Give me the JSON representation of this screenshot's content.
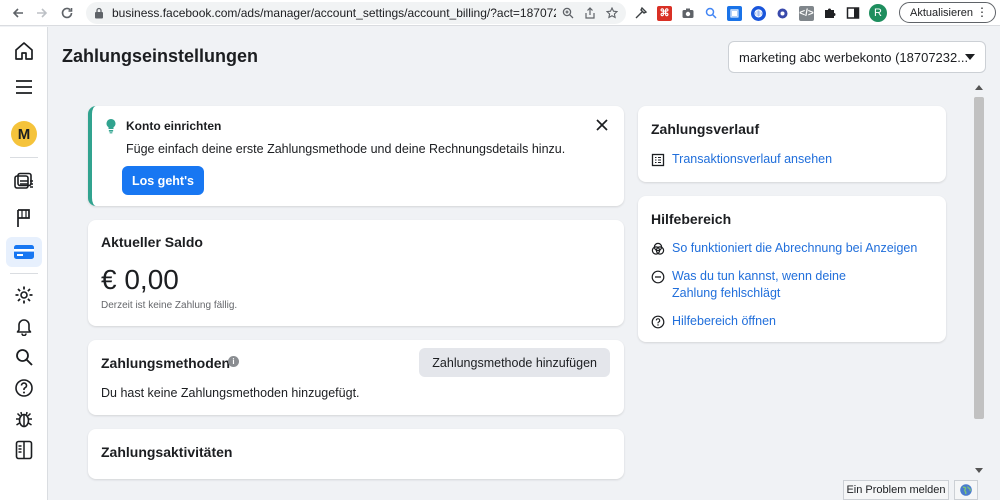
{
  "browser": {
    "url": "business.facebook.com/ads/manager/account_settings/account_billing/?act=187072327...",
    "update_label": "Aktualisieren",
    "profile_initial": "R"
  },
  "rail": {
    "avatar_initial": "M"
  },
  "header": {
    "title": "Zahlungseinstellungen",
    "account": "marketing abc werbekonto (18707232..."
  },
  "setup": {
    "title": "Konto einrichten",
    "description": "Füge einfach deine erste Zahlungsmethode und deine Rechnungsdetails hinzu.",
    "button": "Los geht's"
  },
  "balance": {
    "title": "Aktueller Saldo",
    "amount": "€ 0,00",
    "note": "Derzeit ist keine Zahlung fällig."
  },
  "methods": {
    "title": "Zahlungsmethoden",
    "add_button": "Zahlungsmethode hinzufügen",
    "empty": "Du hast keine Zahlungsmethoden hinzugefügt."
  },
  "activities": {
    "title": "Zahlungsaktivitäten"
  },
  "history": {
    "title": "Zahlungsverlauf",
    "link": "Transaktionsverlauf ansehen"
  },
  "help": {
    "title": "Hilfebereich",
    "links": [
      "So funktioniert die Abrechnung bei Anzeigen",
      "Was du tun kannst, wenn deine Zahlung fehlschlägt",
      "Hilfebereich öffnen"
    ]
  },
  "footer": {
    "report": "Ein Problem melden"
  },
  "colors": {
    "primary": "#1877f2",
    "link": "#216fdb",
    "accent_bar": "#31a38f",
    "avatar": "#f5c33b"
  }
}
